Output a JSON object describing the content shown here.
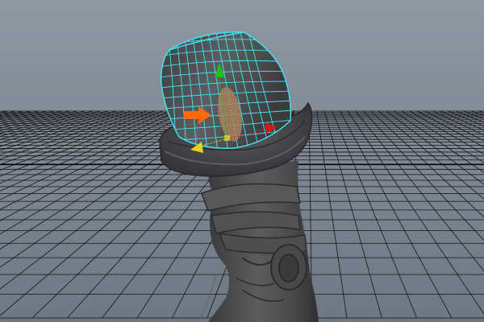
{
  "viewport": {
    "background_top": "#8e98a3",
    "background_bottom": "#6d7884",
    "grid_color": "#141414",
    "grid_axis_color": "#000000",
    "wireframe_color": "#3ee8f5",
    "mesh_color": "#4a4b4d",
    "mesh_highlight": "#6e7072",
    "selection_color": "#c98a4a"
  },
  "manipulator": {
    "x_axis_color": "#d81414",
    "y_axis_color": "#1fbf1f",
    "z_axis_color": "#e6d21a",
    "direction_arrow_color": "#ff6a0a",
    "icons": [
      "move-manipulator-icon",
      "direction-arrow-icon"
    ]
  },
  "objects": [
    {
      "name": "boot-mesh",
      "kind": "polygon-mesh"
    },
    {
      "name": "sock-mesh",
      "kind": "polygon-mesh",
      "selected": true
    }
  ]
}
